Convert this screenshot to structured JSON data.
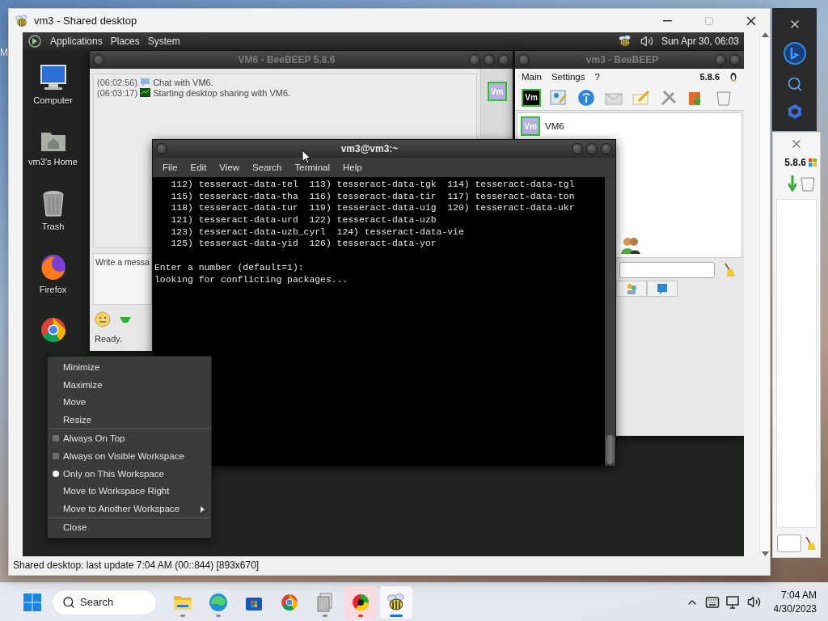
{
  "wallpaper_label": "M",
  "host_window": {
    "title": "vm3 - Shared desktop",
    "status": "Shared desktop: last update 7:04 AM (00::844) [893x670]"
  },
  "remote_desktop": {
    "panel": {
      "menus": [
        "Applications",
        "Places",
        "System"
      ],
      "clock": "Sun Apr 30, 06:03"
    },
    "desktop_icons": [
      {
        "kind": "computer",
        "label": "Computer"
      },
      {
        "kind": "home",
        "label": "vm3's Home"
      },
      {
        "kind": "trash",
        "label": "Trash"
      },
      {
        "kind": "firefox",
        "label": "Firefox"
      },
      {
        "kind": "chrome"
      }
    ],
    "chat_window": {
      "title": "VM6 - BeeBEEP 5.8.6",
      "log": [
        {
          "kind": "chat",
          "time": "(06:02:56)",
          "text": "Chat with VM6."
        },
        {
          "kind": "share",
          "time": "(06:03:17)",
          "text": "Starting desktop sharing with VM6."
        }
      ],
      "avatar": "Vm",
      "message_placeholder": "Write a messa",
      "status": "Ready."
    },
    "main_window": {
      "title": "vm3 - BeeBEEP",
      "menus": [
        "Main",
        "Settings",
        "?"
      ],
      "version": "5.8.6",
      "avatar": "Vm",
      "users": [
        {
          "avatar": "Vm",
          "name": "VM6"
        }
      ]
    },
    "terminal": {
      "title": "vm3@vm3:~",
      "menus": [
        "File",
        "Edit",
        "View",
        "Search",
        "Terminal",
        "Help"
      ],
      "list_lines": [
        "   112) tesseract-data-tel  113) tesseract-data-tgk  114) tesseract-data-tgl",
        "   115) tesseract-data-tha  116) tesseract-data-tir  117) tesseract-data-ton",
        "   118) tesseract-data-tur  119) tesseract-data-uig  120) tesseract-data-ukr",
        "   121) tesseract-data-urd  122) tesseract-data-uzb",
        "   123) tesseract-data-uzb_cyrl  124) tesseract-data-vie",
        "   125) tesseract-data-yid  126) tesseract-data-yor"
      ],
      "output_lines": [
        "Enter a number (default=1):",
        "looking for conflicting packages..."
      ]
    },
    "context_menu": {
      "groups": [
        [
          {
            "kind": "plain",
            "label": "Minimize"
          },
          {
            "kind": "plain",
            "label": "Maximize"
          },
          {
            "kind": "plain",
            "label": "Move"
          },
          {
            "kind": "plain",
            "label": "Resize"
          }
        ],
        [
          {
            "kind": "check",
            "label": "Always On Top",
            "checked": false
          },
          {
            "kind": "check",
            "label": "Always on Visible Workspace",
            "checked": false
          },
          {
            "kind": "radio",
            "label": "Only on This Workspace",
            "selected": true
          },
          {
            "kind": "plain",
            "label": "Move to Workspace Right"
          },
          {
            "kind": "submenu",
            "label": "Move to Another Workspace"
          }
        ],
        [
          {
            "kind": "plain",
            "label": "Close"
          }
        ]
      ]
    }
  },
  "side_window": {
    "version": "5.8.6"
  },
  "taskbar": {
    "search": "Search",
    "apps": [
      {
        "kind": "explorer",
        "running": true,
        "attention": false,
        "selected": false
      },
      {
        "kind": "edge",
        "running": true,
        "attention": false,
        "selected": false
      },
      {
        "kind": "store",
        "running": false,
        "attention": false,
        "selected": false
      },
      {
        "kind": "chrome",
        "running": false,
        "attention": false,
        "selected": false
      },
      {
        "kind": "archive",
        "running": true,
        "attention": false,
        "selected": false
      },
      {
        "kind": "chart",
        "running": true,
        "attention": true,
        "selected": false
      },
      {
        "kind": "bee",
        "running": true,
        "attention": false,
        "selected": true
      }
    ],
    "time": "7:04 AM",
    "date": "4/30/2023"
  }
}
